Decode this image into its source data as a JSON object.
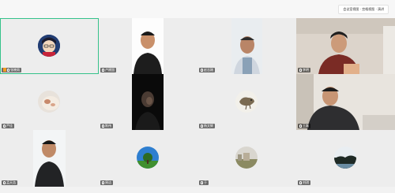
{
  "view_switch": {
    "label": "会议室视图 · 宫格视图 · 演讲"
  },
  "participants": [
    {
      "name": "张晓雨",
      "host": true
    },
    {
      "name": "卢建国"
    },
    {
      "name": "赵志刚"
    },
    {
      "name": "李明"
    },
    {
      "name": "严佳"
    },
    {
      "name": "陈伟"
    },
    {
      "name": "杨文辉"
    },
    {
      "name": "王磊"
    },
    {
      "name": "孟天浩"
    },
    {
      "name": "周洁"
    },
    {
      "name": "于"
    },
    {
      "name": "刘琪"
    }
  ]
}
